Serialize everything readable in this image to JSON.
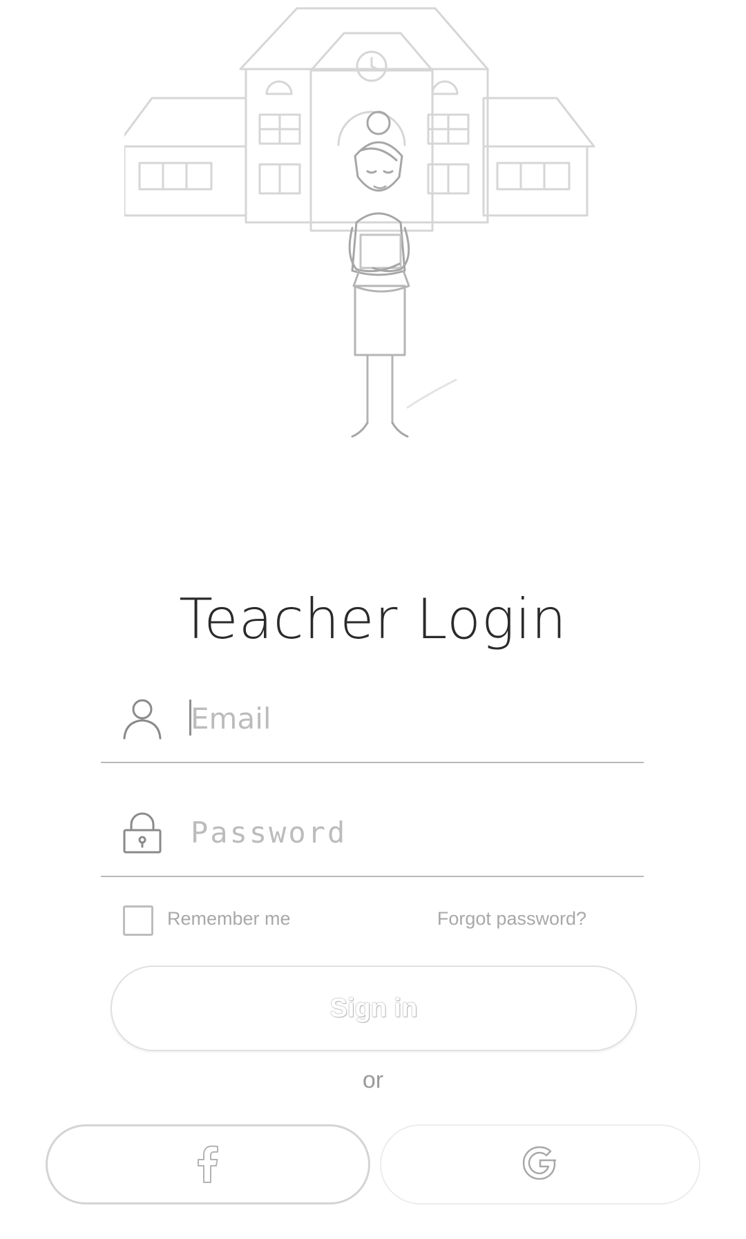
{
  "login": {
    "title": "Teacher Login",
    "email_placeholder": "Email",
    "password_placeholder": "Password",
    "remember_label": "Remember me",
    "forgot_label": "Forgot password?",
    "signin_label": "Sign in",
    "or_label": "or"
  },
  "icons": {
    "email": "user-icon",
    "password": "lock-icon",
    "facebook": "facebook-icon",
    "google": "google-icon"
  },
  "colors": {
    "background": "#ffffff",
    "title": "#2a2a2a",
    "muted_text": "#9a9a9a",
    "field_underline": "#b8b8b8",
    "button_border": "#e0e0e0"
  }
}
